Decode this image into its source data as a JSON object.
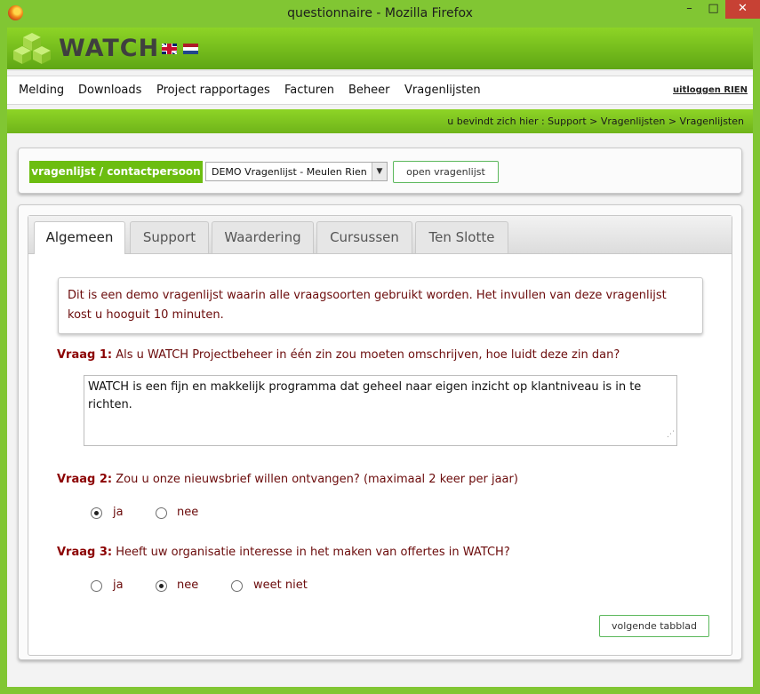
{
  "window": {
    "title": "questionnaire - Mozilla Firefox",
    "min": "–",
    "max": "□",
    "close": "✕"
  },
  "header": {
    "logo": "WATCH"
  },
  "menu": {
    "items": [
      "Melding",
      "Downloads",
      "Project rapportages",
      "Facturen",
      "Beheer",
      "Vragenlijsten"
    ],
    "logout": "uitloggen RIEN"
  },
  "breadcrumb": "u bevindt zich hier : Support > Vragenlijsten > Vragenlijsten",
  "selector": {
    "label": "vragenlijst / contactpersoon",
    "selected": "DEMO Vragenlijst - Meulen Rien",
    "open_button": "open vragenlijst"
  },
  "tabs": [
    "Algemeen",
    "Support",
    "Waardering",
    "Cursussen",
    "Ten Slotte"
  ],
  "intro": "Dit is een demo vragenlijst waarin alle vraagsoorten gebruikt worden. Het invullen van deze vragenlijst kost u hooguit 10 minuten.",
  "questions": [
    {
      "label": "Vraag 1:",
      "text": "Als u WATCH Projectbeheer in één zin zou moeten omschrijven, hoe luidt deze zin dan?",
      "answer": "WATCH is een fijn en makkelijk programma dat geheel naar eigen inzicht op klantniveau is in te richten."
    },
    {
      "label": "Vraag 2:",
      "text": "Zou u onze nieuwsbrief willen ontvangen? (maximaal 2 keer per jaar)",
      "options": [
        "ja",
        "nee"
      ],
      "selected": "ja"
    },
    {
      "label": "Vraag 3:",
      "text": "Heeft uw organisatie interesse in het maken van offertes in WATCH?",
      "options": [
        "ja",
        "nee",
        "weet niet"
      ],
      "selected": "nee"
    }
  ],
  "next_button": "volgende tabblad"
}
